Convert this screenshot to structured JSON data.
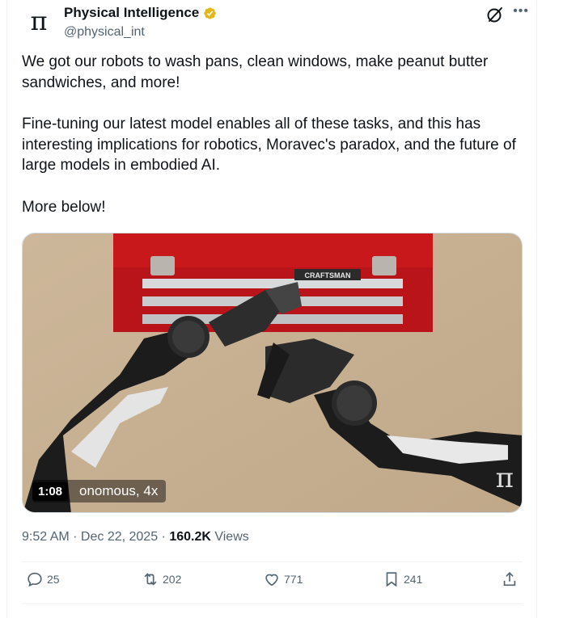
{
  "author": {
    "avatar_glyph": "π",
    "display_name": "Physical Intelligence",
    "handle": "@physical_int",
    "verified_color": "#e2b719"
  },
  "tweet": {
    "paragraphs": [
      "We got our robots to wash pans, clean windows, make peanut butter sandwiches, and more!",
      "Fine-tuning our latest model enables all of these tasks, and this has interesting implications for robotics, Moravec's paradox, and the future of large models in embodied AI.",
      "More below!"
    ]
  },
  "media": {
    "duration": "1:08",
    "caption": "onomous, 4x",
    "toolbox_label": "CRAFTSMAN",
    "watermark_glyph": "π"
  },
  "meta": {
    "time": "9:52 AM",
    "sep1": " · ",
    "date": "Dec 22, 2025",
    "sep2": " · ",
    "views_count": "160.2K",
    "views_label": " Views"
  },
  "actions": {
    "replies": "25",
    "reposts": "202",
    "likes": "771",
    "bookmarks": "241"
  },
  "icons": {
    "top_right": [
      "grok-icon",
      "more-icon"
    ],
    "bar": [
      "reply-icon",
      "repost-icon",
      "like-icon",
      "bookmark-icon",
      "share-icon"
    ]
  }
}
